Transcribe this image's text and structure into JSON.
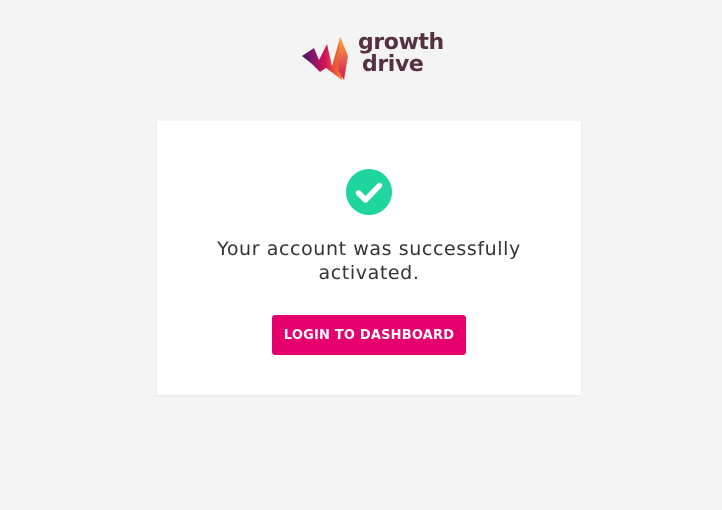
{
  "logo": {
    "line1": "growth",
    "line2": "drive",
    "text_color": "#553142",
    "mark_colors": [
      "#3b1a6e",
      "#d4145a",
      "#f7931e"
    ]
  },
  "card": {
    "icon": "check-circle-icon",
    "icon_color": "#1ed69e",
    "message": "Your account was successfully activated."
  },
  "actions": {
    "login_label": "LOGIN TO DASHBOARD",
    "button_color": "#e6006e"
  }
}
